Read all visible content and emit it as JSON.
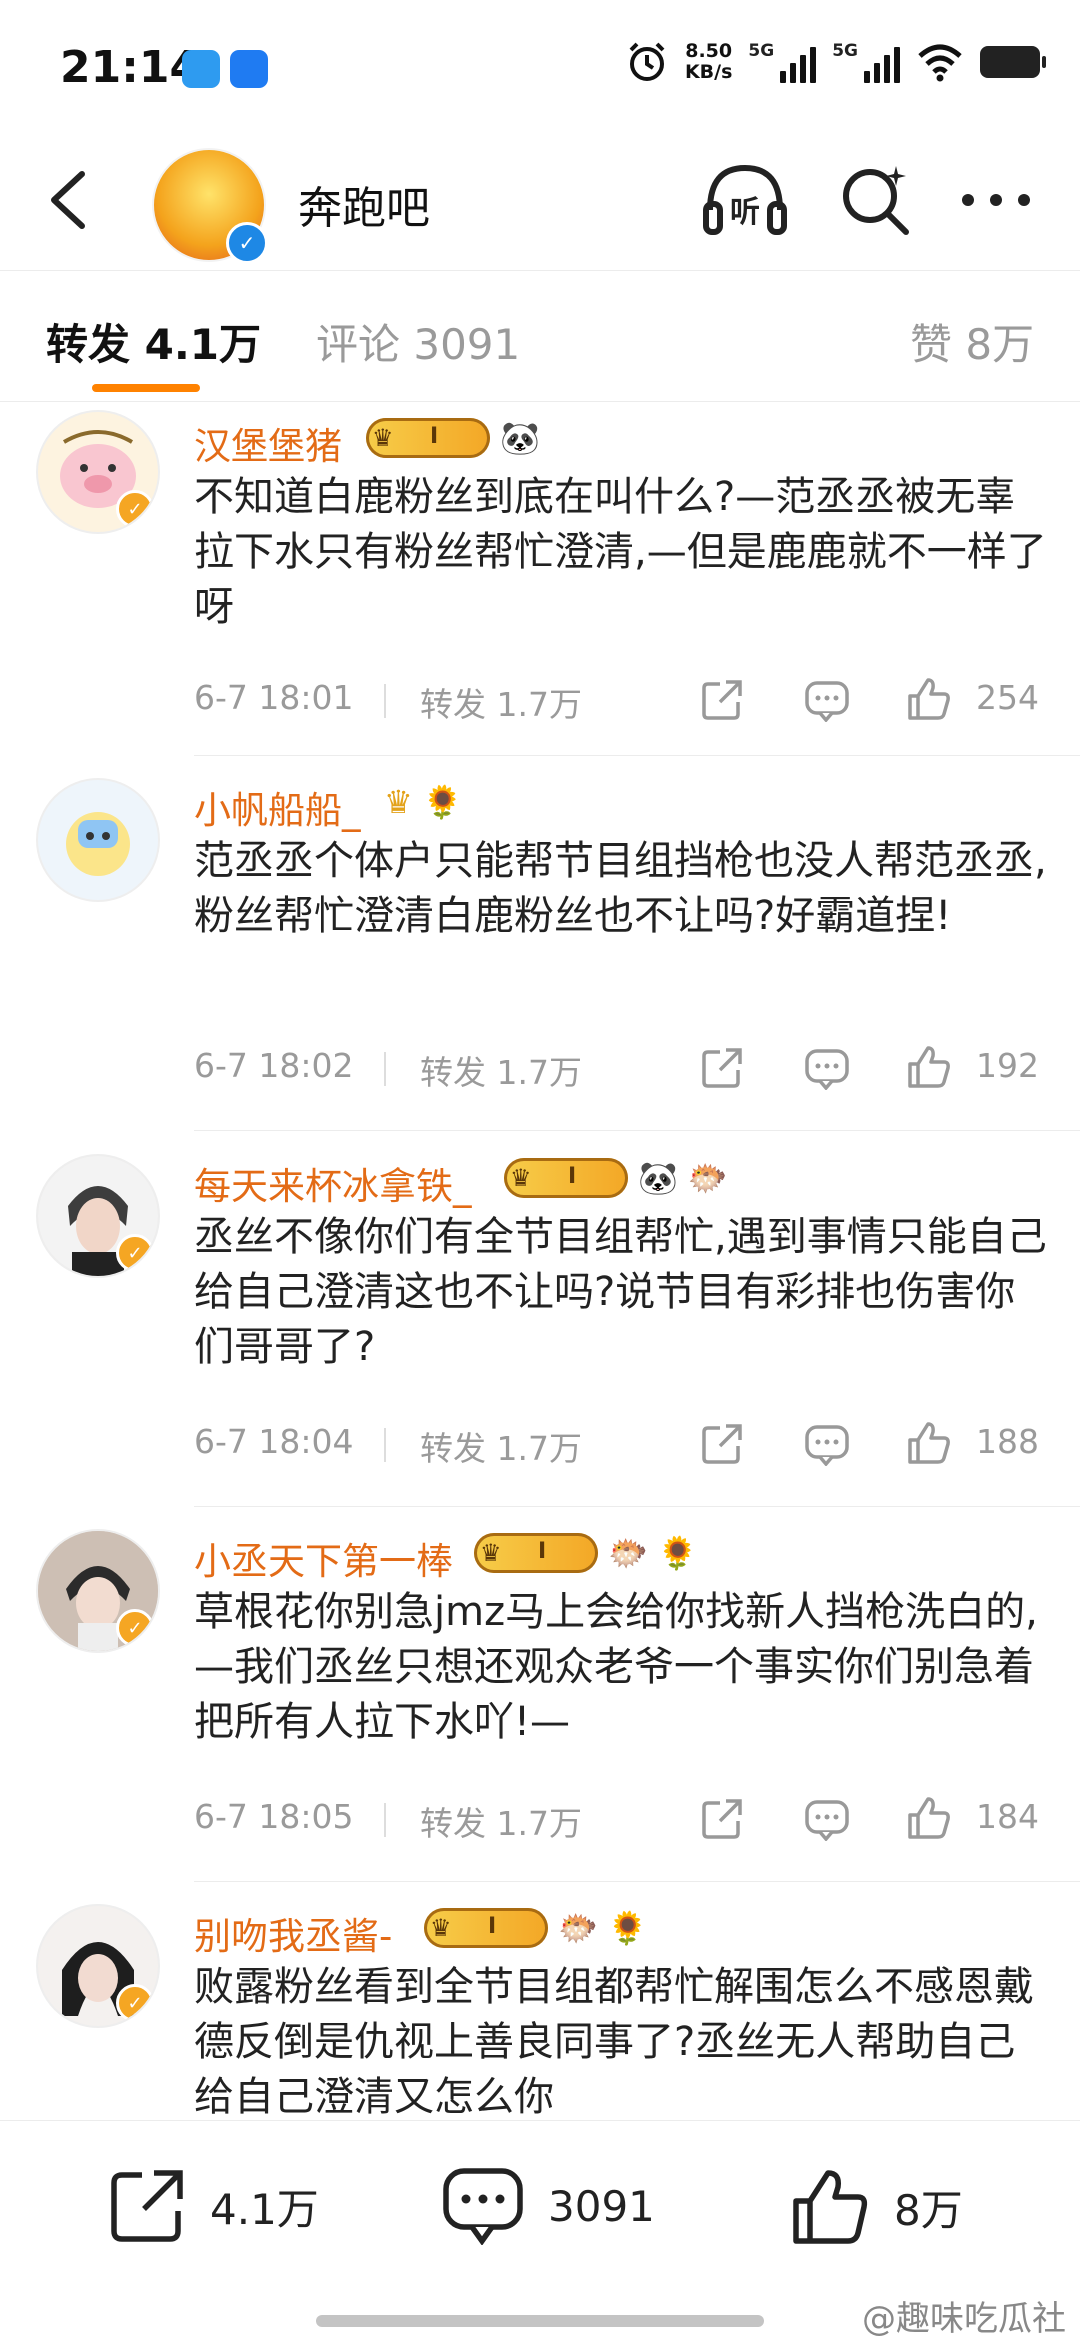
{
  "status_bar": {
    "time": "21:14",
    "net_speed_value": "8.50",
    "net_speed_unit": "KB/s",
    "sim1": "5G",
    "sim2": "5G"
  },
  "header": {
    "title": "奔跑吧",
    "listen_label": "听"
  },
  "tabs": [
    {
      "label": "转发 4.1万"
    },
    {
      "label": "评论 3091"
    },
    {
      "label": "赞 8万"
    }
  ],
  "comments": [
    {
      "name": "汉堡堡猪",
      "badge": "I",
      "extra_badges": [
        "🐼"
      ],
      "text": "不知道白鹿粉丝到底在叫什么?—范丞丞被无辜拉下水只有粉丝帮忙澄清,—但是鹿鹿就不一样了呀",
      "time": "6-7 18:01",
      "repost": "转发 1.7万",
      "likes": "254"
    },
    {
      "name": "小帆船船_",
      "badge": "",
      "extra_badges": [
        "🌻"
      ],
      "text": "范丞丞个体户只能帮节目组挡枪也没人帮范丞丞,粉丝帮忙澄清白鹿粉丝也不让吗?好霸道捏!",
      "time": "6-7 18:02",
      "repost": "转发 1.7万",
      "likes": "192"
    },
    {
      "name": "每天来杯冰拿铁_",
      "badge": "I",
      "extra_badges": [
        "🐼",
        "🐡"
      ],
      "text": "丞丝不像你们有全节目组帮忙,遇到事情只能自己给自己澄清这也不让吗?说节目有彩排也伤害你们哥哥了?",
      "time": "6-7 18:04",
      "repost": "转发 1.7万",
      "likes": "188"
    },
    {
      "name": "小丞天下第一棒",
      "badge": "I",
      "extra_badges": [
        "🐡",
        "🌻"
      ],
      "text": "草根花你别急jmz马上会给你找新人挡枪洗白的,—我们丞丝只想还观众老爷一个事实你们别急着把所有人拉下水吖!—",
      "time": "6-7 18:05",
      "repost": "转发 1.7万",
      "likes": "184"
    },
    {
      "name": "别吻我丞酱-",
      "badge": "I",
      "extra_badges": [
        "🐡",
        "🌻"
      ],
      "text": "败露粉丝看到全节目组都帮忙解围怎么不感恩戴德反倒是仇视上善良同事了?丞丝无人帮助自己给自己澄清又怎么你",
      "time": "",
      "repost": "",
      "likes": ""
    }
  ],
  "bottom_bar": {
    "repost": "4.1万",
    "comments": "3091",
    "likes": "8万"
  },
  "watermark": "@趣味吃瓜社"
}
